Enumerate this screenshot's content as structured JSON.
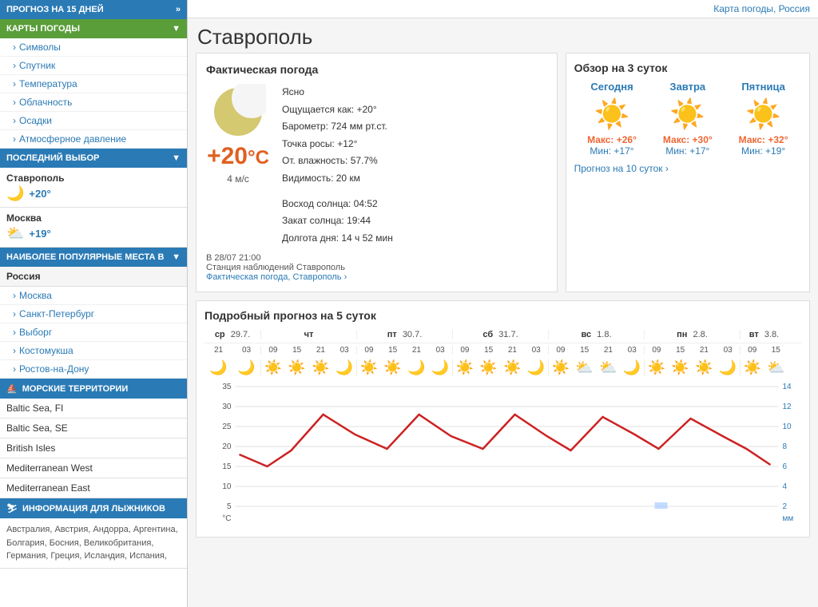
{
  "topbar": {
    "link": "Карта погоды, Россия"
  },
  "sidebar": {
    "forecast_header": "ПРОГНОЗ НА 15 ДНЕЙ",
    "maps_header": "КАРТЫ ПОГОДЫ",
    "nav_items": [
      "Символы",
      "Спутник",
      "Температура",
      "Облачность",
      "Осадки",
      "Атмосферное давление"
    ],
    "last_choice_header": "ПОСЛЕДНИЙ ВЫБОР",
    "last_items": [
      {
        "city": "Ставрополь",
        "temp": "+20°"
      },
      {
        "city": "Москва",
        "temp": "+19°"
      }
    ],
    "popular_header": "НАИБОЛЕЕ ПОПУЛЯРНЫЕ МЕСТА В",
    "russia_label": "Россия",
    "russia_cities": [
      "Москва",
      "Санкт-Петербург",
      "Выборг",
      "Костомукша",
      "Ростов-на-Дону"
    ],
    "marine_header": "МОРСКИЕ ТЕРРИТОРИИ",
    "marine_items": [
      "Baltic Sea, FI",
      "Baltic Sea, SE",
      "British Isles",
      "Mediterranean West",
      "Mediterranean East"
    ],
    "ski_header": "ИНФОРМАЦИЯ ДЛЯ ЛЫЖНИКОВ",
    "ski_countries": "Австралия, Австрия, Андорра, Аргентина, Болгария, Босния, Великобритания, Германия, Греция, Исландия, Испания,"
  },
  "main": {
    "city": "Ставрополь",
    "current": {
      "title": "Фактическая погода",
      "temp": "+20",
      "unit": "°C",
      "wind": "4 м/с",
      "condition": "Ясно",
      "feels_like": "Ощущается как: +20°",
      "pressure": "Барометр: 724 мм рт.ст.",
      "dew_point": "Точка росы: +12°",
      "humidity": "От. влажность: 57.7%",
      "visibility": "Видимость: 20 км",
      "sunrise": "Восход солнца: 04:52",
      "sunset": "Закат солнца: 19:44",
      "daylight": "Долгота дня: 14 ч 52 мин",
      "timestamp": "В 28/07 21:00",
      "station": "Станция наблюдений Ставрополь",
      "link": "Фактическая погода, Ставрополь ›"
    },
    "overview": {
      "title": "Обзор на 3 суток",
      "days": [
        {
          "name": "Сегодня",
          "max": "Макс: +26°",
          "min": "Мин: +17°"
        },
        {
          "name": "Завтра",
          "max": "Макс: +30°",
          "min": "Мин: +17°"
        },
        {
          "name": "Пятница",
          "max": "Макс: +32°",
          "min": "Мин: +19°"
        }
      ],
      "forecast_link": "Прогноз на 10 суток ›"
    },
    "forecast": {
      "title": "Подробный прогноз на 5 суток",
      "days": [
        {
          "name": "ср",
          "date": "29.7.",
          "slots": [
            "21",
            "03",
            "09",
            "15"
          ]
        },
        {
          "name": "чт",
          "date": "",
          "slots": [
            "21",
            "03",
            "09",
            "15"
          ]
        },
        {
          "name": "пт",
          "date": "30.7.",
          "slots": [
            "21",
            "03",
            "09",
            "15"
          ]
        },
        {
          "name": "сб",
          "date": "31.7.",
          "slots": [
            "21",
            "03",
            "09",
            "15"
          ]
        },
        {
          "name": "вс",
          "date": "1.8.",
          "slots": [
            "21",
            "03",
            "09",
            "15"
          ]
        },
        {
          "name": "пн",
          "date": "2.8.",
          "slots": [
            "21",
            "03",
            "09",
            "15"
          ]
        },
        {
          "name": "вт",
          "date": "3.8.",
          "slots": [
            "21",
            "03"
          ]
        }
      ]
    },
    "chart": {
      "left_axis": [
        "35",
        "30",
        "25",
        "20",
        "15",
        "10",
        "5",
        "°C"
      ],
      "right_axis": [
        "14",
        "12",
        "10",
        "8",
        "6",
        "4",
        "2",
        "мм"
      ]
    }
  }
}
